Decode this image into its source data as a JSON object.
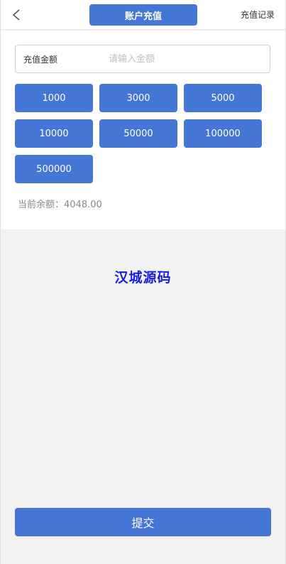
{
  "header": {
    "title": "账户充值",
    "records_link": "充值记录",
    "back_icon": "chevron-left-icon"
  },
  "form": {
    "amount_label": "充值金额",
    "amount_value": "",
    "amount_placeholder": "请输入金额"
  },
  "presets": [
    "1000",
    "3000",
    "5000",
    "10000",
    "50000",
    "100000",
    "500000"
  ],
  "balance": {
    "text": "当前余额：4048.00"
  },
  "watermark": "汉城源码",
  "submit_label": "提交",
  "colors": {
    "accent": "#4576d6",
    "watermark": "#1a1ae0",
    "background": "#f2f2f2"
  }
}
